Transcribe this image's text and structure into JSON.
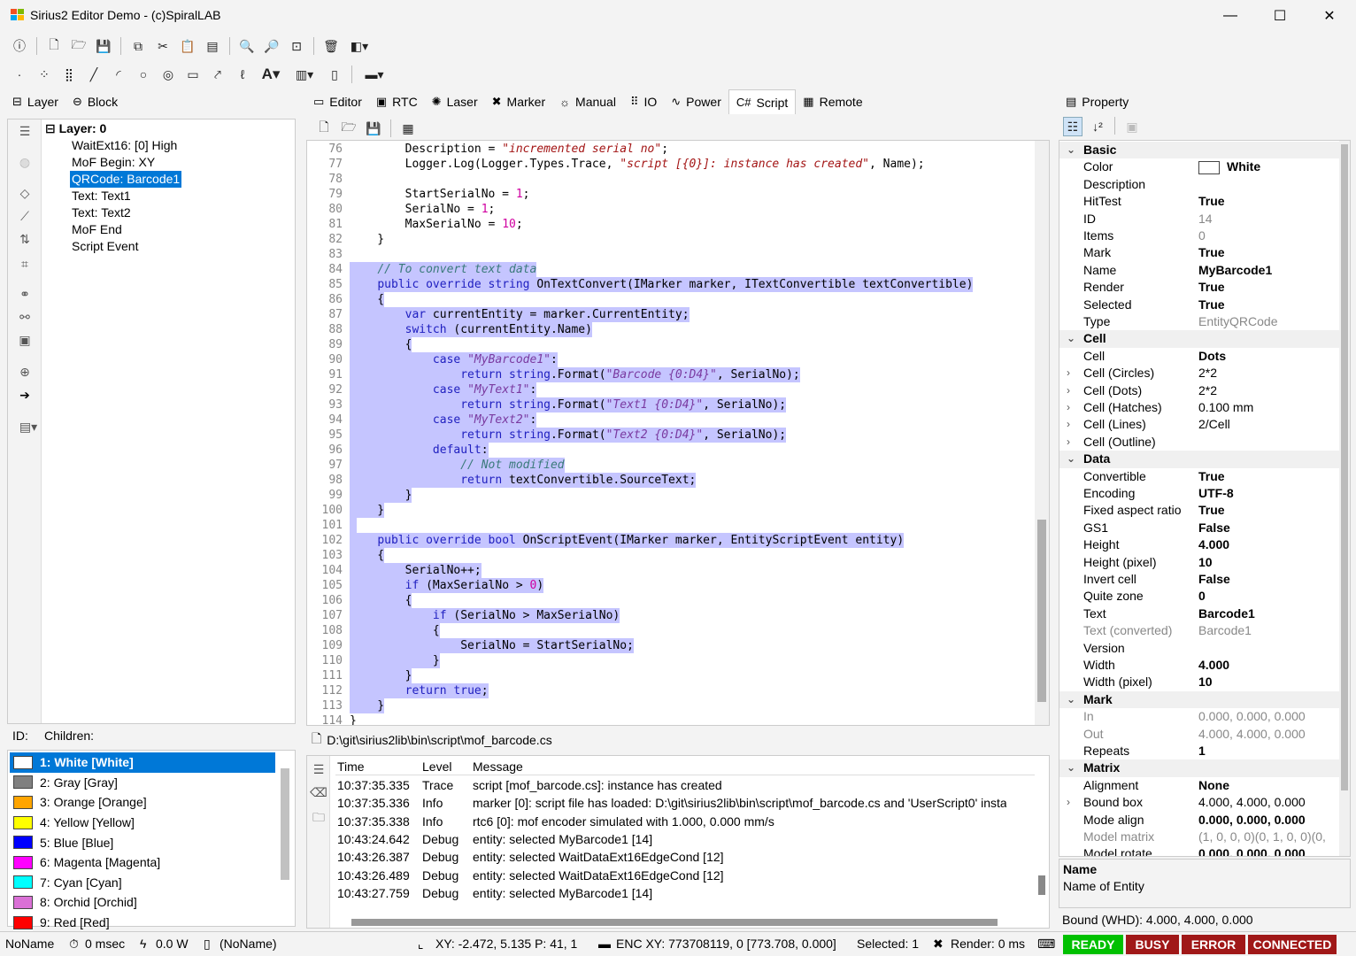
{
  "window": {
    "title": "Sirius2 Editor Demo - (c)SpiralLAB",
    "minimize": "—",
    "maximize": "☐",
    "close": "✕"
  },
  "left_tabs": [
    {
      "icon": "layer-icon",
      "label": "Layer"
    },
    {
      "icon": "block-icon",
      "label": "Block"
    }
  ],
  "tree": {
    "root": "Layer: 0",
    "children": [
      "WaitExt16: [0] High",
      "MoF Begin: XY",
      "QRCode: Barcode1",
      "Text: Text1",
      "Text: Text2",
      "MoF End",
      "Script Event"
    ],
    "selected": "QRCode: Barcode1"
  },
  "idbar": {
    "id_label": "ID:",
    "children_label": "Children:"
  },
  "pens": [
    {
      "label": "1: White [White]",
      "color": "#ffffff"
    },
    {
      "label": "2: Gray [Gray]",
      "color": "#808080"
    },
    {
      "label": "3: Orange [Orange]",
      "color": "#ffa500"
    },
    {
      "label": "4: Yellow [Yellow]",
      "color": "#ffff00"
    },
    {
      "label": "5: Blue [Blue]",
      "color": "#0000ff"
    },
    {
      "label": "6: Magenta [Magenta]",
      "color": "#ff00ff"
    },
    {
      "label": "7: Cyan [Cyan]",
      "color": "#00ffff"
    },
    {
      "label": "8: Orchid [Orchid]",
      "color": "#da70d6"
    },
    {
      "label": "9: Red [Red]",
      "color": "#ff0000"
    }
  ],
  "center_tabs": [
    {
      "icon": "editor-icon",
      "label": "Editor"
    },
    {
      "icon": "rtc-icon",
      "label": "RTC"
    },
    {
      "icon": "laser-icon",
      "label": "Laser"
    },
    {
      "icon": "marker-icon",
      "label": "Marker"
    },
    {
      "icon": "manual-icon",
      "label": "Manual"
    },
    {
      "icon": "io-icon",
      "label": "IO"
    },
    {
      "icon": "power-icon",
      "label": "Power"
    },
    {
      "icon": "script-icon",
      "label": "Script"
    },
    {
      "icon": "remote-icon",
      "label": "Remote"
    }
  ],
  "active_center_tab": "Script",
  "editor": {
    "lines": [
      {
        "n": "76",
        "html": "        Description = <span class=\"str\">\"incremented serial no\"</span>;",
        "hl": false
      },
      {
        "n": "77",
        "html": "        Logger.Log(Logger.Types.Trace, <span class=\"str\">\"script [{0}]: instance has created\"</span>, Name);",
        "hl": false
      },
      {
        "n": "78",
        "html": "",
        "hl": false
      },
      {
        "n": "79",
        "html": "        StartSerialNo = <span class=\"num\">1</span>;",
        "hl": false
      },
      {
        "n": "80",
        "html": "        SerialNo = <span class=\"num\">1</span>;",
        "hl": false
      },
      {
        "n": "81",
        "html": "        MaxSerialNo = <span class=\"num\">10</span>;",
        "hl": false
      },
      {
        "n": "82",
        "html": "    }",
        "hl": false
      },
      {
        "n": "83",
        "html": "",
        "hl": false
      },
      {
        "n": "84",
        "html": "    <span class=\"cm\">// To convert text data</span>",
        "hl": true
      },
      {
        "n": "85",
        "html": "    <span class=\"kw\">public override string</span> OnTextConvert(IMarker marker, ITextConvertible textConvertible)",
        "hl": true
      },
      {
        "n": "86",
        "html": "    {",
        "hl": true
      },
      {
        "n": "87",
        "html": "        <span class=\"kw\">var</span> currentEntity = marker.CurrentEntity;",
        "hl": true
      },
      {
        "n": "88",
        "html": "        <span class=\"kw\">switch</span> (currentEntity.Name)",
        "hl": true
      },
      {
        "n": "89",
        "html": "        {",
        "hl": true
      },
      {
        "n": "90",
        "html": "            <span class=\"kw\">case</span> <span class=\"str2\">\"MyBarcode1\"</span>:",
        "hl": true
      },
      {
        "n": "91",
        "html": "                <span class=\"kw\">return string</span>.Format(<span class=\"str2\">\"Barcode {0:D4}\"</span>, SerialNo);",
        "hl": true
      },
      {
        "n": "92",
        "html": "            <span class=\"kw\">case</span> <span class=\"str2\">\"MyText1\"</span>:",
        "hl": true
      },
      {
        "n": "93",
        "html": "                <span class=\"kw\">return string</span>.Format(<span class=\"str2\">\"Text1 {0:D4}\"</span>, SerialNo);",
        "hl": true
      },
      {
        "n": "94",
        "html": "            <span class=\"kw\">case</span> <span class=\"str2\">\"MyText2\"</span>:",
        "hl": true
      },
      {
        "n": "95",
        "html": "                <span class=\"kw\">return string</span>.Format(<span class=\"str2\">\"Text2 {0:D4}\"</span>, SerialNo);",
        "hl": true
      },
      {
        "n": "96",
        "html": "            <span class=\"kw\">default</span>:",
        "hl": true
      },
      {
        "n": "97",
        "html": "                <span class=\"cm\">// Not modified</span>",
        "hl": true
      },
      {
        "n": "98",
        "html": "                <span class=\"kw\">return</span> textConvertible.SourceText;",
        "hl": true
      },
      {
        "n": "99",
        "html": "        }",
        "hl": true
      },
      {
        "n": "100",
        "html": "    }",
        "hl": true
      },
      {
        "n": "101",
        "html": "",
        "hl": true
      },
      {
        "n": "102",
        "html": "    <span class=\"kw\">public override bool</span> OnScriptEvent(IMarker marker, EntityScriptEvent entity)",
        "hl": true
      },
      {
        "n": "103",
        "html": "    {",
        "hl": true
      },
      {
        "n": "104",
        "html": "        SerialNo++;",
        "hl": true
      },
      {
        "n": "105",
        "html": "        <span class=\"kw\">if</span> (MaxSerialNo > <span class=\"num\">0</span>)",
        "hl": true
      },
      {
        "n": "106",
        "html": "        {",
        "hl": true
      },
      {
        "n": "107",
        "html": "            <span class=\"kw\">if</span> (SerialNo > MaxSerialNo)",
        "hl": true
      },
      {
        "n": "108",
        "html": "            {",
        "hl": true
      },
      {
        "n": "109",
        "html": "                SerialNo = StartSerialNo;",
        "hl": true
      },
      {
        "n": "110",
        "html": "            }",
        "hl": true
      },
      {
        "n": "111",
        "html": "        }",
        "hl": true
      },
      {
        "n": "112",
        "html": "        <span class=\"kw\">return true</span>;",
        "hl": true
      },
      {
        "n": "113",
        "html": "    }",
        "hl": true
      },
      {
        "n": "114",
        "html": "}",
        "hl": false
      }
    ]
  },
  "filepath": "D:\\git\\sirius2lib\\bin\\script\\mof_barcode.cs",
  "log": {
    "headers": {
      "time": "Time",
      "level": "Level",
      "message": "Message"
    },
    "rows": [
      {
        "time": "10:37:35.335",
        "level": "Trace",
        "message": "script [mof_barcode.cs]: instance has created"
      },
      {
        "time": "10:37:35.336",
        "level": "Info",
        "message": "marker [0]: script file has loaded: D:\\git\\sirius2lib\\bin\\script\\mof_barcode.cs and 'UserScript0' instan"
      },
      {
        "time": "10:37:35.338",
        "level": "Info",
        "message": "rtc6 [0]: mof encoder simulated with 1.000, 0.000 mm/s"
      },
      {
        "time": "10:43:24.642",
        "level": "Debug",
        "message": "entity: selected MyBarcode1 [14]"
      },
      {
        "time": "10:43:26.387",
        "level": "Debug",
        "message": "entity: selected WaitDataExt16EdgeCond [12]"
      },
      {
        "time": "10:43:26.489",
        "level": "Debug",
        "message": "entity: selected WaitDataExt16EdgeCond [12]"
      },
      {
        "time": "10:43:27.759",
        "level": "Debug",
        "message": "entity: selected MyBarcode1 [14]"
      }
    ]
  },
  "property": {
    "title": "Property",
    "rows": [
      {
        "cat": true,
        "k": "Basic"
      },
      {
        "k": "Color",
        "v": "White",
        "swatch": "#ffffff",
        "b": true
      },
      {
        "k": "Description",
        "v": ""
      },
      {
        "k": "HitTest",
        "v": "True",
        "b": true
      },
      {
        "k": "ID",
        "v": "14",
        "gray": true
      },
      {
        "k": "Items",
        "v": "0",
        "gray": true
      },
      {
        "k": "Mark",
        "v": "True",
        "b": true
      },
      {
        "k": "Name",
        "v": "MyBarcode1",
        "b": true
      },
      {
        "k": "Render",
        "v": "True",
        "b": true
      },
      {
        "k": "Selected",
        "v": "True",
        "b": true
      },
      {
        "k": "Type",
        "v": "EntityQRCode",
        "gray": true
      },
      {
        "cat": true,
        "k": "Cell"
      },
      {
        "k": "Cell",
        "v": "Dots",
        "b": true
      },
      {
        "k": "Cell (Circles)",
        "v": "2*2",
        "ex": true
      },
      {
        "k": "Cell (Dots)",
        "v": "2*2",
        "ex": true
      },
      {
        "k": "Cell (Hatches)",
        "v": "0.100 mm",
        "ex": true
      },
      {
        "k": "Cell (Lines)",
        "v": "2/Cell",
        "ex": true
      },
      {
        "k": "Cell (Outline)",
        "v": "",
        "ex": true
      },
      {
        "cat": true,
        "k": "Data"
      },
      {
        "k": "Convertible",
        "v": "True",
        "b": true
      },
      {
        "k": "Encoding",
        "v": "UTF-8",
        "b": true
      },
      {
        "k": "Fixed aspect ratio",
        "v": "True",
        "b": true
      },
      {
        "k": "GS1",
        "v": "False",
        "b": true
      },
      {
        "k": "Height",
        "v": "4.000",
        "b": true
      },
      {
        "k": "Height (pixel)",
        "v": "10",
        "b": true
      },
      {
        "k": "Invert cell",
        "v": "False",
        "b": true
      },
      {
        "k": "Quite zone",
        "v": "0",
        "b": true
      },
      {
        "k": "Text",
        "v": "Barcode1",
        "b": true
      },
      {
        "k": "Text (converted)",
        "v": "Barcode1",
        "gray": true,
        "kgray": true
      },
      {
        "k": "Version",
        "v": ""
      },
      {
        "k": "Width",
        "v": "4.000",
        "b": true
      },
      {
        "k": "Width (pixel)",
        "v": "10",
        "b": true
      },
      {
        "cat": true,
        "k": "Mark"
      },
      {
        "k": "In",
        "v": "0.000, 0.000, 0.000",
        "gray": true,
        "kgray": true
      },
      {
        "k": "Out",
        "v": "4.000, 4.000, 0.000",
        "gray": true,
        "kgray": true
      },
      {
        "k": "Repeats",
        "v": "1",
        "b": true
      },
      {
        "cat": true,
        "k": "Matrix"
      },
      {
        "k": "Alignment",
        "v": "None",
        "b": true
      },
      {
        "k": "Bound box",
        "v": "4.000, 4.000, 0.000",
        "ex": true
      },
      {
        "k": "Mode align",
        "v": "0.000, 0.000, 0.000",
        "b": true
      },
      {
        "k": "Model matrix",
        "v": "(1, 0, 0, 0)(0, 1, 0, 0)(0,",
        "gray": true,
        "kgray": true
      },
      {
        "k": "Model rotate",
        "v": "0.000, 0.000, 0.000",
        "b": true
      }
    ],
    "desc_title": "Name",
    "desc_text": "Name of Entity",
    "bound": "Bound (WHD): 4.000, 4.000, 0.000"
  },
  "status": {
    "name": "NoName",
    "time": "0 msec",
    "power": "0.0 W",
    "doc": "(NoName)",
    "xy": "XY: -2.472, 5.135  P: 41, 1",
    "enc": "ENC XY: 773708119, 0 [773.708, 0.000]",
    "selected": "Selected: 1",
    "render": "Render: 0 ms",
    "ready": "READY",
    "busy": "BUSY",
    "error": "ERROR",
    "connected": "CONNECTED",
    "ready_color": "#00c000",
    "busy_color": "#a01818",
    "error_color": "#a01818",
    "connected_color": "#a01818"
  }
}
